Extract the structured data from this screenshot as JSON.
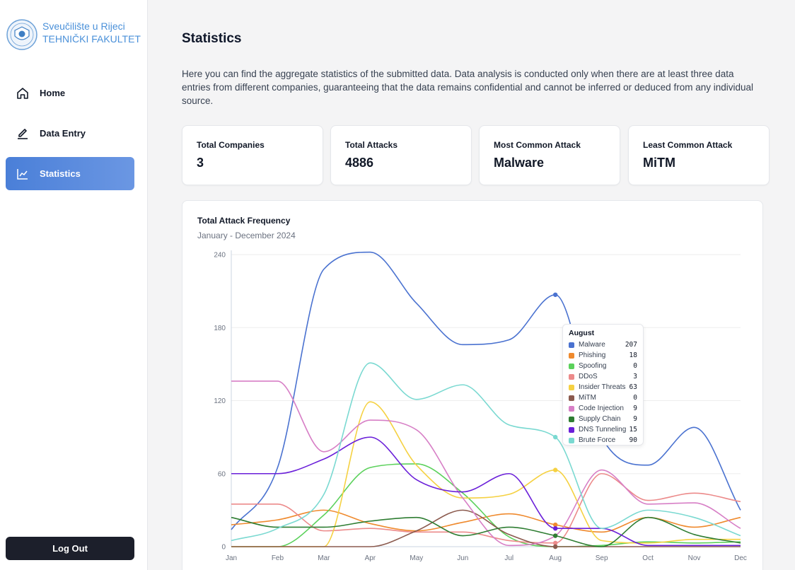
{
  "sidebar": {
    "logo_line1": "Sveučilište u Rijeci",
    "logo_line2": "TEHNIČKI FAKULTET",
    "items": [
      {
        "label": "Home",
        "icon": "home-icon",
        "active": false
      },
      {
        "label": "Data Entry",
        "icon": "pencil-icon",
        "active": false
      },
      {
        "label": "Statistics",
        "icon": "line-chart-icon",
        "active": true
      }
    ],
    "logout_label": "Log Out"
  },
  "main": {
    "title": "Statistics",
    "intro": "Here you can find the aggregate statistics of the submitted data. Data analysis is conducted only when there are at least three data entries from different companies, guaranteeing that the data remains confidential and cannot be inferred or deduced from any individual source.",
    "stats": [
      {
        "label": "Total Companies",
        "value": "3"
      },
      {
        "label": "Total Attacks",
        "value": "4886"
      },
      {
        "label": "Most Common Attack",
        "value": "Malware"
      },
      {
        "label": "Least Common Attack",
        "value": "MiTM"
      }
    ],
    "chart_title": "Total Attack Frequency",
    "chart_subtitle": "January - December 2024"
  },
  "colors": {
    "accent": "#4a7fd8",
    "logout_bg": "#1c1f2b"
  },
  "chart_data": {
    "type": "line",
    "title": "Total Attack Frequency",
    "subtitle": "January - December 2024",
    "categories": [
      "Jan",
      "Feb",
      "Mar",
      "Apr",
      "May",
      "Jun",
      "Jul",
      "Aug",
      "Sep",
      "Oct",
      "Nov",
      "Dec"
    ],
    "yticks": [
      0,
      60,
      120,
      180,
      240
    ],
    "ylim": [
      0,
      240
    ],
    "xlabel": "",
    "ylabel": "",
    "grid": "horizontal",
    "highlight_index": 7,
    "series": [
      {
        "name": "Malware",
        "color": "#4a72d0",
        "values": [
          14,
          65,
          228,
          242,
          200,
          166,
          170,
          207,
          90,
          67,
          98,
          30
        ]
      },
      {
        "name": "Phishing",
        "color": "#ef8a2e",
        "values": [
          18,
          22,
          30,
          19,
          13,
          20,
          27,
          18,
          12,
          24,
          16,
          24
        ]
      },
      {
        "name": "Spoofing",
        "color": "#5bd15b",
        "values": [
          0,
          0,
          26,
          65,
          68,
          44,
          8,
          0,
          1,
          4,
          3,
          4
        ]
      },
      {
        "name": "DDoS",
        "color": "#ec8a8a",
        "values": [
          35,
          35,
          13,
          15,
          12,
          12,
          5,
          3,
          60,
          38,
          44,
          37
        ]
      },
      {
        "name": "Insider Threats",
        "color": "#f5d142",
        "values": [
          0,
          0,
          0,
          119,
          67,
          40,
          43,
          63,
          5,
          3,
          6,
          6
        ]
      },
      {
        "name": "MiTM",
        "color": "#8b5a4e",
        "values": [
          0,
          0,
          0,
          0,
          13,
          30,
          10,
          0,
          0,
          0,
          0,
          0
        ]
      },
      {
        "name": "Code Injection",
        "color": "#d77fc6",
        "values": [
          136,
          136,
          78,
          104,
          96,
          40,
          1,
          9,
          63,
          35,
          36,
          15
        ]
      },
      {
        "name": "Supply Chain",
        "color": "#2e7d32",
        "values": [
          24,
          16,
          16,
          21,
          24,
          9,
          16,
          9,
          0,
          24,
          10,
          3
        ]
      },
      {
        "name": "DNS Tunneling",
        "color": "#6a1fd9",
        "values": [
          60,
          60,
          72,
          90,
          55,
          45,
          60,
          15,
          15,
          1,
          1,
          1
        ]
      },
      {
        "name": "Brute Force",
        "color": "#7ad9d1",
        "values": [
          5,
          15,
          43,
          151,
          121,
          133,
          100,
          90,
          15,
          30,
          24,
          9
        ]
      }
    ],
    "tooltip": {
      "title": "August",
      "rows": [
        {
          "name": "Malware",
          "value": "207",
          "color": "#4a72d0"
        },
        {
          "name": "Phishing",
          "value": "18",
          "color": "#ef8a2e"
        },
        {
          "name": "Spoofing",
          "value": "0",
          "color": "#5bd15b"
        },
        {
          "name": "DDoS",
          "value": "3",
          "color": "#ec8a8a"
        },
        {
          "name": "Insider Threats",
          "value": "63",
          "color": "#f5d142"
        },
        {
          "name": "MiTM",
          "value": "0",
          "color": "#8b5a4e"
        },
        {
          "name": "Code Injection",
          "value": "9",
          "color": "#d77fc6"
        },
        {
          "name": "Supply Chain",
          "value": "9",
          "color": "#2e7d32"
        },
        {
          "name": "DNS Tunneling",
          "value": "15",
          "color": "#6a1fd9"
        },
        {
          "name": "Brute Force",
          "value": "90",
          "color": "#7ad9d1"
        }
      ]
    }
  }
}
